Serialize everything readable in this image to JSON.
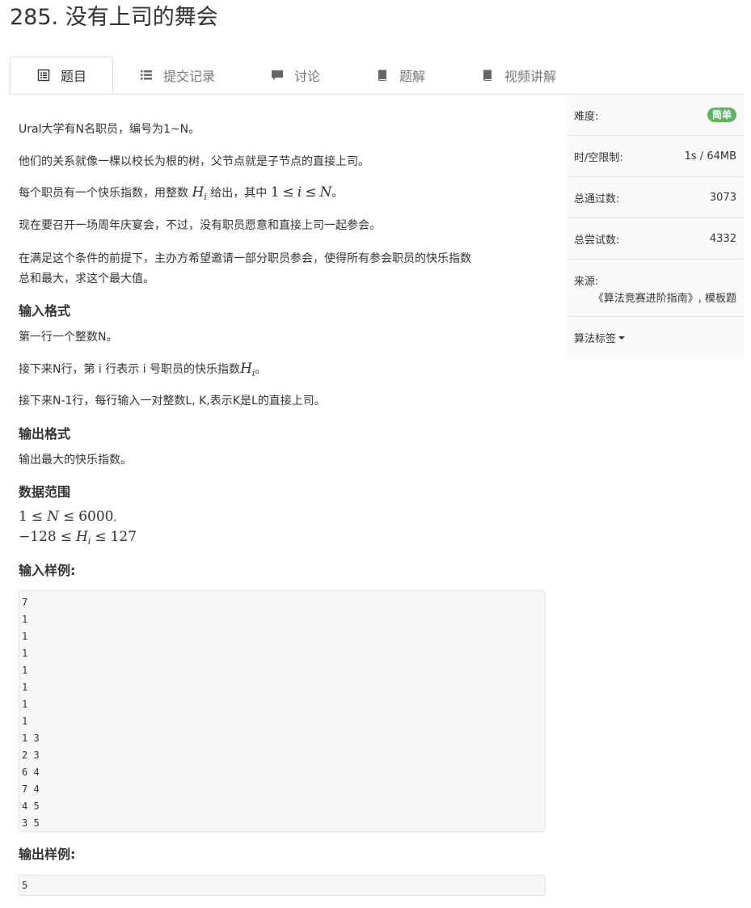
{
  "problem": {
    "title": "285. 没有上司的舞会"
  },
  "tabs": [
    {
      "label": "题目",
      "icon": "list-icon"
    },
    {
      "label": "提交记录",
      "icon": "bullet-list-icon"
    },
    {
      "label": "讨论",
      "icon": "comment-icon"
    },
    {
      "label": "题解",
      "icon": "book-icon"
    },
    {
      "label": "视频讲解",
      "icon": "book-icon"
    }
  ],
  "statement": {
    "p1": "Ural大学有N名职员，编号为1~N。",
    "p2": "他们的关系就像一棵以校长为根的树，父节点就是子节点的直接上司。",
    "p3_pre": "每个职员有一个快乐指数，用整数 ",
    "p3_mid": " 给出，其中 ",
    "p3_end": "。",
    "p4": "现在要召开一场周年庆宴会，不过，没有职员愿意和直接上司一起参会。",
    "p5a": "在满足这个条件的前提下，主办方希望邀请一部分职员参会，使得所有参会职员的快乐指数",
    "p5b": "总和最大，求这个最大值。",
    "input_head": "输入格式",
    "in1": "第一行一个整数N。",
    "in2_pre": "接下来N行，第 i 行表示 i 号职员的快乐指数",
    "in2_end": "。",
    "in3": "接下来N-1行，每行输入一对整数L, K,表示K是L的直接上司。",
    "output_head": "输出格式",
    "out1": "输出最大的快乐指数。",
    "range_head": "数据范围",
    "range1_end": ",",
    "sample_in_head": "输入样例:",
    "sample_out_head": "输出样例:"
  },
  "math": {
    "H": "H",
    "i": "i",
    "one": "1",
    "le": "≤",
    "N": "N",
    "n6000": "6000",
    "neg128": "−128",
    "n127": "127"
  },
  "sample_input": [
    "7",
    "1",
    "1",
    "1",
    "1",
    "1",
    "1",
    "1",
    "1 3",
    "2 3",
    "6 4",
    "7 4",
    "4 5",
    "3 5"
  ],
  "sample_output": [
    "5"
  ],
  "sidebar": {
    "difficulty_label": "难度:",
    "difficulty_value": "简单",
    "limit_label": "时/空限制:",
    "limit_value": "1s / 64MB",
    "accepted_label": "总通过数:",
    "accepted_value": "3073",
    "attempts_label": "总尝试数:",
    "attempts_value": "4332",
    "source_label": "来源:",
    "source_value": "《算法竞赛进阶指南》, 模板题",
    "tags_label": "算法标签"
  },
  "colors": {
    "badge_green": "#5cb85c",
    "tab_border": "#dddddd",
    "code_bg": "#f7f7f9"
  }
}
